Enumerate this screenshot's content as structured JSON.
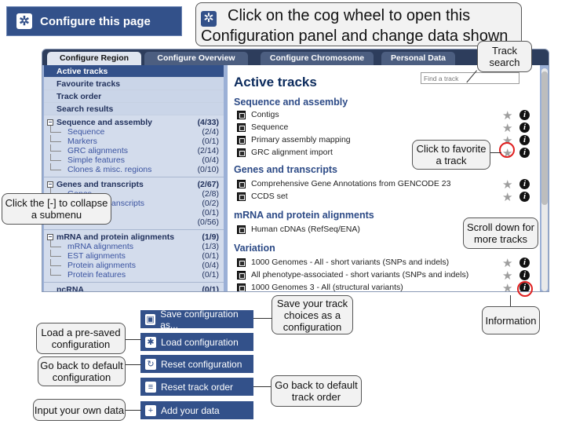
{
  "top_button": {
    "label": "Configure this page",
    "icon": "cog-icon"
  },
  "callouts": {
    "main": "Click on the cog wheel to open this Configuration panel and change data shown",
    "track_search": "Track search",
    "collapse": "Click the [-] to collapse a submenu",
    "favorite": "Click to favorite a track",
    "scroll": "Scroll down for more tracks",
    "information": "Information",
    "save": "Save your track choices as a configuration",
    "load": "Load a pre-saved configuration",
    "reset": "Go back to default configuration",
    "reset_order": "Go back to default track order",
    "add_data": "Input your own data"
  },
  "tabs": [
    {
      "label": "Configure Region Image"
    },
    {
      "label": "Configure Overview Image"
    },
    {
      "label": "Configure Chromosome Image"
    },
    {
      "label": "Personal Data"
    }
  ],
  "sidebar": {
    "heads": [
      "Active tracks",
      "Favourite tracks",
      "Track order",
      "Search results"
    ],
    "cat1": {
      "label": "Sequence and assembly",
      "count": "(4/33)",
      "items": [
        {
          "label": "Sequence",
          "count": "(2/4)"
        },
        {
          "label": "Markers",
          "count": "(0/1)"
        },
        {
          "label": "GRC alignments",
          "count": "(2/14)"
        },
        {
          "label": "Simple features",
          "count": "(0/4)"
        },
        {
          "label": "Clones & misc. regions",
          "count": "(0/10)"
        }
      ]
    },
    "cat2": {
      "label": "Genes and transcripts",
      "count": "(2/67)",
      "items": [
        {
          "label": "Genes",
          "count": "(2/8)"
        },
        {
          "label": "Prediction transcripts",
          "count": "(0/2)"
        },
        {
          "label": "",
          "count": "(0/1)"
        },
        {
          "label": "",
          "count": "(0/56)"
        }
      ]
    },
    "cat3": {
      "label": "mRNA and protein alignments",
      "count": "(1/9)",
      "items": [
        {
          "label": "mRNA alignments",
          "count": "(1/3)"
        },
        {
          "label": "EST alignments",
          "count": "(0/1)"
        },
        {
          "label": "Protein alignments",
          "count": "(0/4)"
        },
        {
          "label": "Protein features",
          "count": "(0/1)"
        }
      ]
    },
    "cat4": {
      "label": "ncRNA",
      "count": "(0/1)"
    }
  },
  "content": {
    "title": "Active tracks",
    "search_placeholder": "Find a track",
    "sections": {
      "seq": "Sequence and assembly",
      "genes": "Genes and transcripts",
      "mrna": "mRNA and protein alignments",
      "var": "Variation"
    },
    "tracks": {
      "contigs": "Contigs",
      "sequence": "Sequence",
      "primary": "Primary assembly mapping",
      "grc": "GRC alignment import",
      "gencode": "Comprehensive Gene Annotations from GENCODE 23",
      "ccds": "CCDS set",
      "cdnas": "Human cDNAs (RefSeq/ENA)",
      "g1000": "1000 Genomes - All - short variants (SNPs and indels)",
      "pheno": "All phenotype-associated - short variants (SNPs and indels)",
      "g1000sv": "1000 Genomes 3 - All (structural variants)"
    }
  },
  "buttons": {
    "save": "Save configuration as...",
    "load": "Load configuration",
    "reset": "Reset configuration",
    "reset_order": "Reset track order",
    "add": "Add your data"
  },
  "colors": {
    "accent": "#33518a",
    "highlight": "#e02020"
  }
}
